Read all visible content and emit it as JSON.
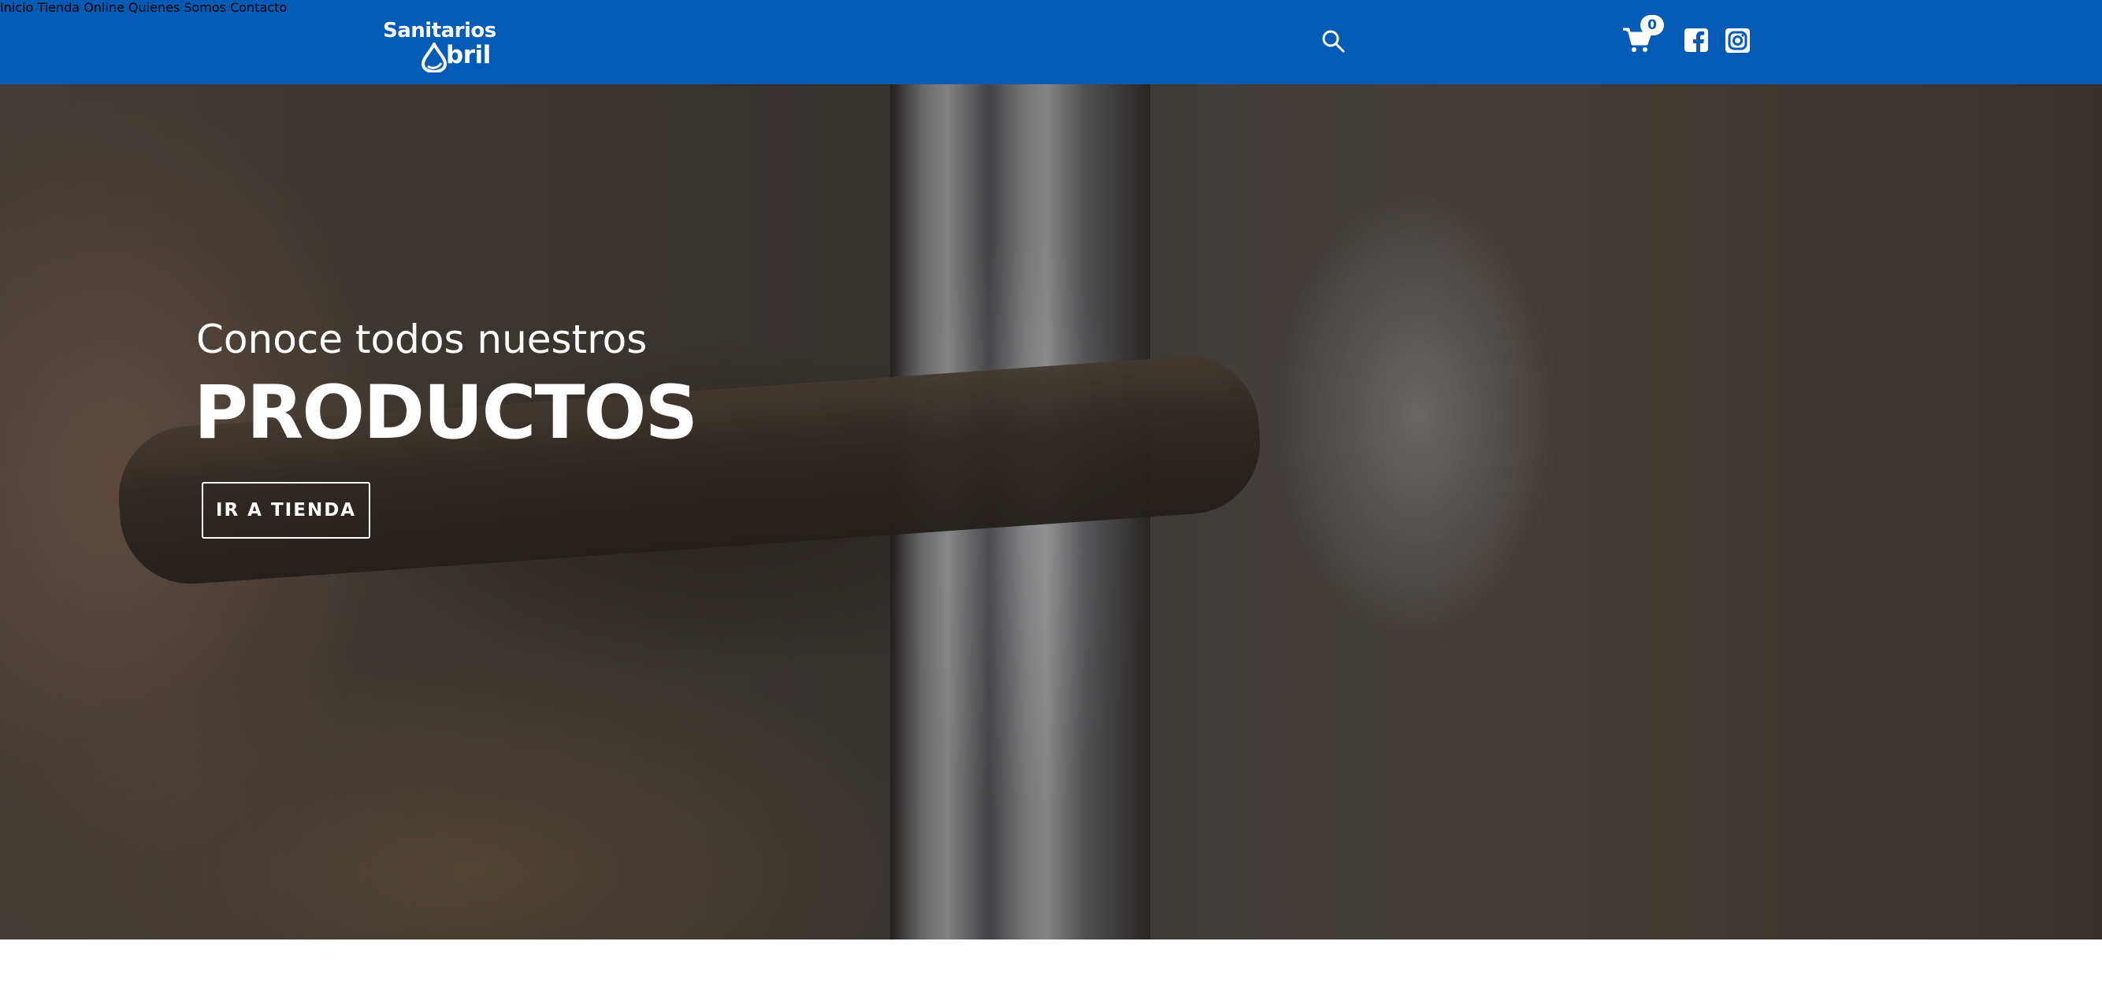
{
  "header": {
    "logo": {
      "line1": "Sanitarios",
      "line2": "bril"
    },
    "nav": [
      {
        "label": "Inicio"
      },
      {
        "label": "Tienda Online"
      },
      {
        "label": "Quienes Somos"
      },
      {
        "label": "Contacto"
      }
    ],
    "cart_count": "0",
    "icons": {
      "search": "search-icon",
      "cart": "cart-icon",
      "facebook": "facebook-icon",
      "instagram": "instagram-icon"
    },
    "colors": {
      "brand": "#045bb6"
    }
  },
  "hero": {
    "subtitle": "Conoce todos nuestros",
    "title": "PRODUCTOS",
    "button_label": "IR A TIENDA"
  }
}
